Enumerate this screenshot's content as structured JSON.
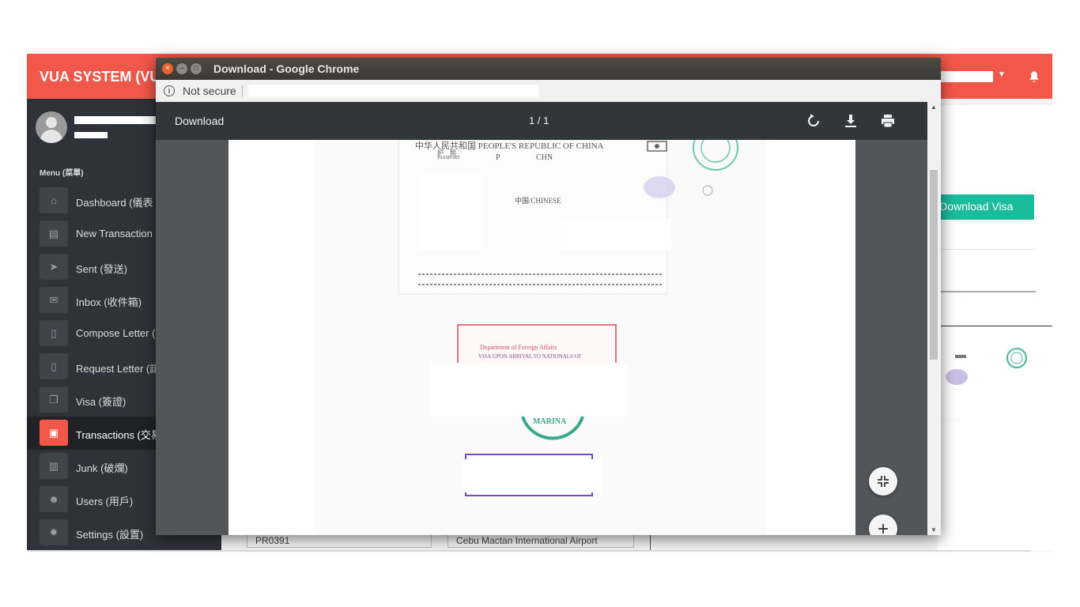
{
  "app": {
    "brand": "VUA SYSTEM (VU",
    "menu_heading": "Menu (菜單)",
    "nav": [
      {
        "label": "Dashboard (儀表",
        "icon": "home-icon"
      },
      {
        "label": "New Transaction",
        "icon": "newspaper-icon"
      },
      {
        "label": "Sent (發送)",
        "icon": "paper-plane-icon"
      },
      {
        "label": "Inbox (收件箱)",
        "icon": "envelope-icon"
      },
      {
        "label": "Compose Letter (",
        "icon": "file-icon"
      },
      {
        "label": "Request Letter (請",
        "icon": "pdf-file-icon"
      },
      {
        "label": "Visa (簽證)",
        "icon": "copy-icon"
      },
      {
        "label": "Transactions (交易",
        "icon": "archive-icon"
      },
      {
        "label": "Junk (破爛)",
        "icon": "trash-icon"
      },
      {
        "label": "Users (用戶)",
        "icon": "users-icon"
      },
      {
        "label": "Settings (設置)",
        "icon": "gear-icon"
      }
    ],
    "active_nav": "Transactions (交易",
    "download_visa_label": "Download Visa",
    "fields": {
      "code": "PR0391",
      "airport": "Cebu Mactan International Airport"
    }
  },
  "chrome": {
    "window_title": "Download - Google Chrome",
    "security_label": "Not secure",
    "accent_close": "#e8622f"
  },
  "viewer": {
    "doc_title": "Download",
    "page_indicator": "1 / 1",
    "document": {
      "passport_header": "中华人民共和国  PEOPLE'S REPUBLIC OF CHINA",
      "passport_label_cn": "护　照",
      "passport_label_en": "PASSPORT",
      "type_value": "P",
      "country_code": "CHN",
      "nationality": "中国/CHINESE",
      "stamp_text": "VISA UPON ARRIVAL TO NATIONALS OF",
      "stamp_dept": "Department of Foreign Affairs",
      "seal_text": "MARINA"
    }
  },
  "colors": {
    "header": "#f2584a",
    "sidebar": "#2f3238",
    "download_visa": "#1abc9c",
    "viewer_toolbar": "#323639",
    "viewer_bg": "#525659"
  }
}
